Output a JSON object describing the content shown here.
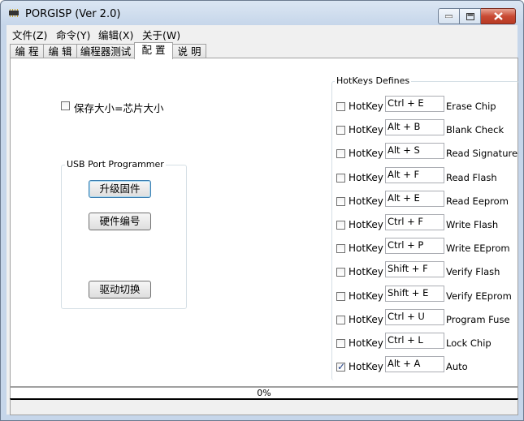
{
  "window": {
    "title": "PORGISP (Ver 2.0)"
  },
  "menu": [
    "文件(Z)",
    "命令(Y)",
    "编辑(X)",
    "关于(W)"
  ],
  "tabs": [
    "编 程",
    "编 辑",
    "编程器测试",
    "配 置",
    "说 明"
  ],
  "active_tab": "配 置",
  "config": {
    "size_checkbox_label": "保存大小=芯片大小",
    "size_checked": false
  },
  "usb_group": {
    "title": "USB Port Programmer",
    "buttons": [
      "升级固件",
      "硬件编号",
      "驱动切换"
    ]
  },
  "hotkeys": {
    "title": "HotKeys Defines",
    "checkbox_label": "HotKey",
    "rows": [
      {
        "key": "Ctrl + E",
        "action": "Erase Chip",
        "checked": false
      },
      {
        "key": "Alt + B",
        "action": "Blank Check",
        "checked": false
      },
      {
        "key": "Alt + S",
        "action": "Read Signature",
        "checked": false
      },
      {
        "key": "Alt + F",
        "action": "Read Flash",
        "checked": false
      },
      {
        "key": "Alt + E",
        "action": "Read Eeprom",
        "checked": false
      },
      {
        "key": "Ctrl + F",
        "action": "Write Flash",
        "checked": false
      },
      {
        "key": "Ctrl + P",
        "action": "Write EEprom",
        "checked": false
      },
      {
        "key": "Shift + F",
        "action": "Verify Flash",
        "checked": false
      },
      {
        "key": "Shift + E",
        "action": "Verify EEprom",
        "checked": false
      },
      {
        "key": "Ctrl + U",
        "action": "Program Fuse",
        "checked": false
      },
      {
        "key": "Ctrl + L",
        "action": "Lock Chip",
        "checked": false
      },
      {
        "key": "Alt + A",
        "action": "Auto",
        "checked": true
      }
    ]
  },
  "progress": {
    "text": "0%",
    "value": 0
  },
  "colors": {
    "close_button": "#c94a34",
    "titlebar": "#dbe6f3",
    "panel": "#ffffff"
  }
}
